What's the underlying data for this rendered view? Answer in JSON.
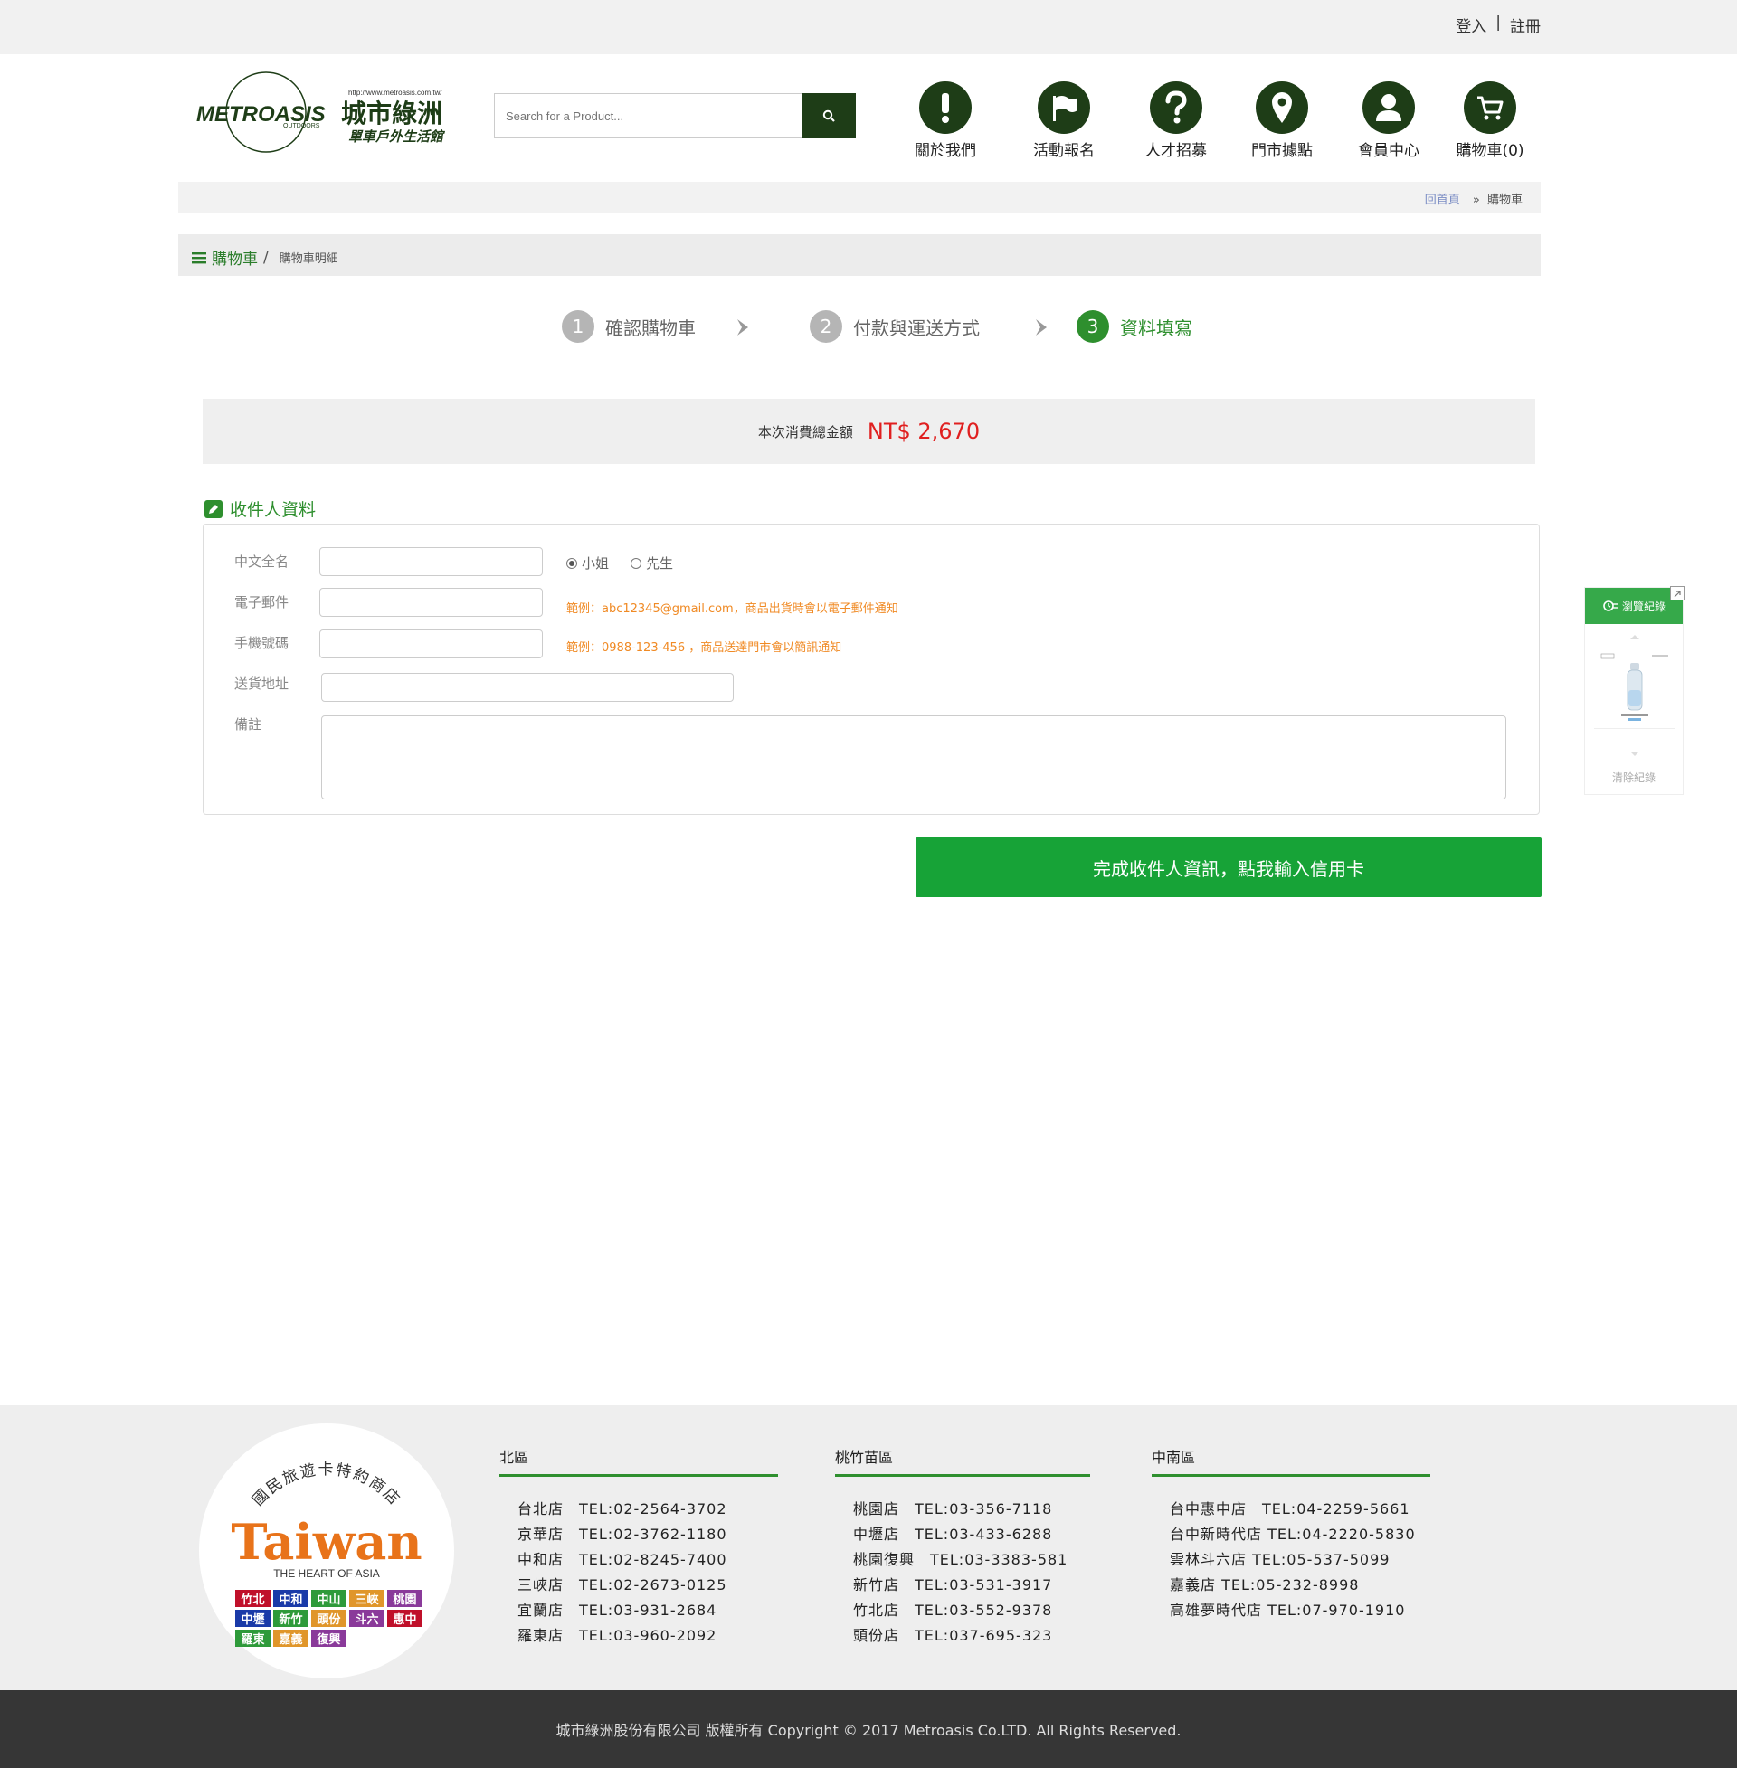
{
  "topbar": {
    "login": "登入",
    "separator": "|",
    "register": "註冊"
  },
  "logo": {
    "brand_en": "METROASIS",
    "outdoors": "OUTDOORS",
    "url": "http://www.metroasis.com.tw/",
    "brand_zh": "城市綠洲",
    "tagline": "單車戶外生活館"
  },
  "search": {
    "placeholder": "Search for a Product..."
  },
  "nav": [
    {
      "label": "關於我們",
      "icon": "exclamation-icon"
    },
    {
      "label": "活動報名",
      "icon": "flag-icon"
    },
    {
      "label": "人才招募",
      "icon": "question-icon"
    },
    {
      "label": "門市據點",
      "icon": "map-pin-icon"
    },
    {
      "label": "會員中心",
      "icon": "user-icon"
    },
    {
      "label": "購物車(0)",
      "icon": "cart-icon"
    }
  ],
  "breadcrumb": {
    "home": "回首頁",
    "current": "購物車"
  },
  "page_title": {
    "title": "購物車",
    "slash": "/",
    "sub": "購物車明細"
  },
  "steps": [
    {
      "num": "1",
      "label": "確認購物車"
    },
    {
      "num": "2",
      "label": "付款與運送方式"
    },
    {
      "num": "3",
      "label": "資料填寫"
    }
  ],
  "total": {
    "label": "本次消費總金額",
    "amount": "NT$ 2,670"
  },
  "recipient": {
    "title": "收件人資料",
    "name_label": "中文全名",
    "miss": "小姐",
    "mr": "先生",
    "email_label": "電子郵件",
    "email_hint": "範例：abc12345@gmail.com，商品出貨時會以電子郵件通知",
    "phone_label": "手機號碼",
    "phone_hint": "範例：0988-123-456 ，商品送達門市會以簡訊通知",
    "address_label": "送貨地址",
    "note_label": "備註"
  },
  "submit": "完成收件人資訊，點我輸入信用卡",
  "history": {
    "title": "瀏覽紀錄",
    "clear": "清除紀錄"
  },
  "footer": {
    "badge": {
      "arc": "國民旅遊卡特約商店",
      "word": "Taiwan",
      "sub": "THE HEART OF ASIA",
      "stores": [
        "竹北",
        "中和",
        "中山",
        "三峽",
        "桃園",
        "中壢",
        "新竹",
        "頭份",
        "斗六",
        "惠中",
        "羅東",
        "嘉義",
        "復興"
      ]
    },
    "regions": [
      {
        "name": "北區",
        "stores": [
          "台北店　TEL:02-2564-3702",
          "京華店　TEL:02-3762-1180",
          "中和店　TEL:02-8245-7400",
          "三峽店　TEL:02-2673-0125",
          "宜蘭店　TEL:03-931-2684",
          "羅東店　TEL:03-960-2092"
        ]
      },
      {
        "name": "桃竹苗區",
        "stores": [
          "桃園店　TEL:03-356-7118",
          "中壢店　TEL:03-433-6288",
          "桃園復興　TEL:03-3383-581",
          "新竹店　TEL:03-531-3917",
          "竹北店　TEL:03-552-9378",
          "頭份店　TEL:037-695-323"
        ]
      },
      {
        "name": "中南區",
        "stores": [
          "台中惠中店　TEL:04-2259-5661",
          "台中新時代店 TEL:04-2220-5830",
          "雲林斗六店 TEL:05-537-5099",
          "嘉義店 TEL:05-232-8998",
          "高雄夢時代店 TEL:07-970-1910"
        ]
      }
    ],
    "copyright": "城市綠洲股份有限公司 版權所有 Copyright © 2017 Metroasis Co.LTD. All Rights Reserved."
  },
  "colors": {
    "brand_dark": "#1e3d17",
    "accent_green": "#2e8f2e",
    "submit_green": "#17a337",
    "price_red": "#e02020",
    "hint_orange": "#f08a24"
  }
}
